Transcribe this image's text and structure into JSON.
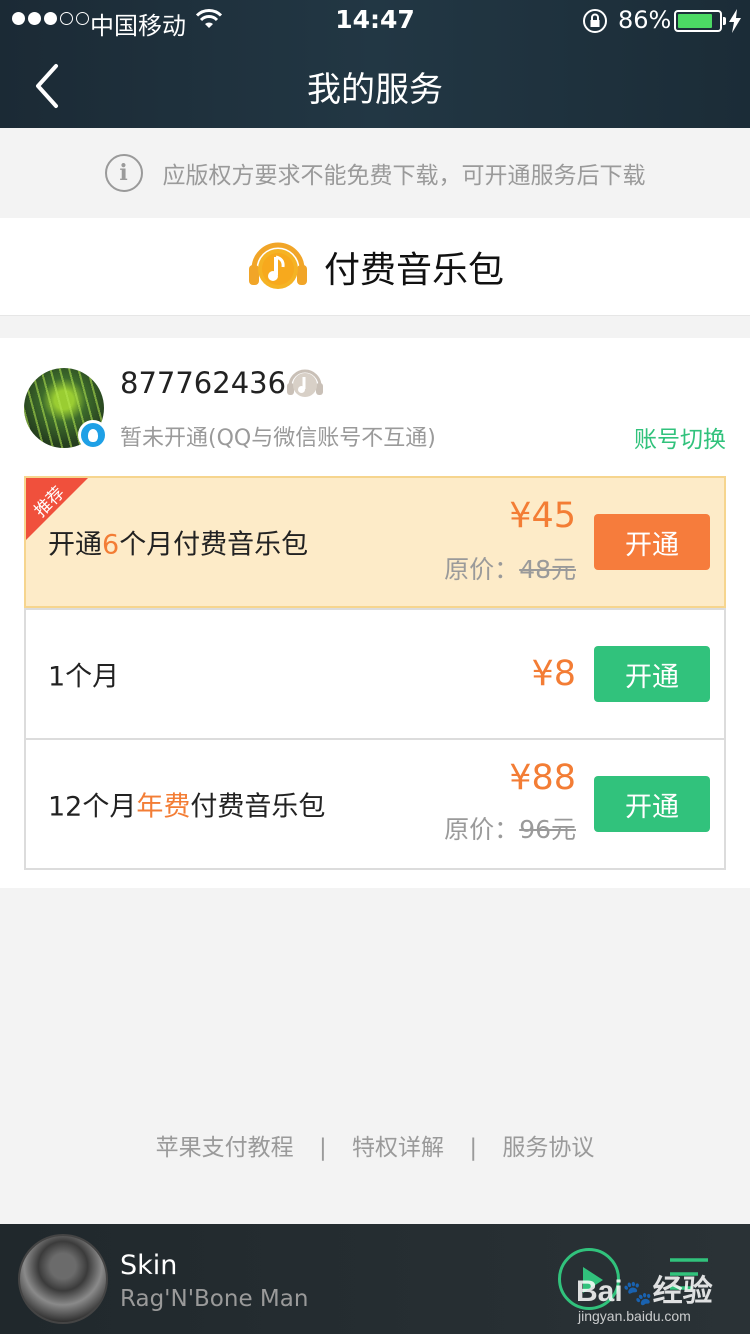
{
  "status_bar": {
    "carrier": "中国移动",
    "time": "14:47",
    "battery_percent": "86%",
    "battery_level": 0.86,
    "signal_bars_filled": 3,
    "signal_bars_total": 5
  },
  "nav": {
    "title": "我的服务",
    "back_icon": "chevron-left-icon"
  },
  "notice": {
    "text": "应版权方要求不能免费下载，可开通服务后下载",
    "icon": "info-icon"
  },
  "pack": {
    "title": "付费音乐包",
    "icon": "music-pack-icon"
  },
  "account": {
    "id": "877762436",
    "status": "暂未开通(QQ与微信账号不互通)",
    "switch_label": "账号切换",
    "badge_icon": "qq-icon"
  },
  "plans": [
    {
      "ribbon": "推荐",
      "name_prefix": "开通",
      "name_highlight": "6",
      "name_suffix": "个月付费音乐包",
      "price": "¥45",
      "original_label": "原价：",
      "original_price": "48元",
      "button": "开通"
    },
    {
      "name_prefix": "1个月",
      "price": "¥8",
      "button": "开通"
    },
    {
      "name_prefix": "12个月",
      "name_highlight": "年费",
      "name_suffix": "付费音乐包",
      "price": "¥88",
      "original_label": "原价：",
      "original_price": "96元",
      "button": "开通"
    }
  ],
  "footer": {
    "links": [
      "苹果支付教程",
      "特权详解",
      "服务协议"
    ],
    "separator": "|"
  },
  "player": {
    "song": "Skin",
    "artist": "Rag'N'Bone Man"
  },
  "watermark": {
    "brand": "Bai",
    "brand2": "经验",
    "url": "jingyan.baidu.com"
  },
  "colors": {
    "accent_green": "#31c27c",
    "accent_orange": "#f37d35",
    "header_bg": "#1f3340",
    "recommend_bg": "#fdebc8"
  }
}
